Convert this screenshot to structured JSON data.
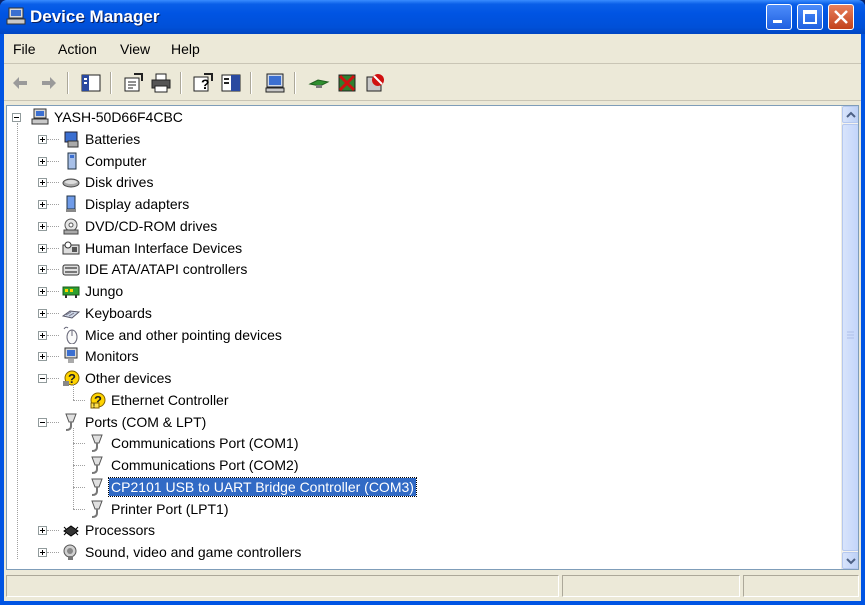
{
  "window": {
    "title": "Device Manager"
  },
  "menubar": {
    "items": [
      "File",
      "Action",
      "View",
      "Help"
    ]
  },
  "toolbar": {
    "buttons": [
      "back-icon",
      "forward-icon",
      "show-hide-tree-icon",
      "properties-icon",
      "print-icon",
      "help-icon",
      "console-tree-icon",
      "scan-hardware-icon",
      "update-driver-icon",
      "disable-icon",
      "uninstall-icon"
    ]
  },
  "tree": {
    "root": "YASH-50D66F4CBC",
    "categories": [
      {
        "label": "Batteries",
        "icon": "battery-icon"
      },
      {
        "label": "Computer",
        "icon": "computer-icon"
      },
      {
        "label": "Disk drives",
        "icon": "disk-drive-icon"
      },
      {
        "label": "Display adapters",
        "icon": "display-adapter-icon"
      },
      {
        "label": "DVD/CD-ROM drives",
        "icon": "dvd-drive-icon"
      },
      {
        "label": "Human Interface Devices",
        "icon": "hid-icon"
      },
      {
        "label": "IDE ATA/ATAPI controllers",
        "icon": "ide-controller-icon"
      },
      {
        "label": "Jungo",
        "icon": "jungo-icon"
      },
      {
        "label": "Keyboards",
        "icon": "keyboard-icon"
      },
      {
        "label": "Mice and other pointing devices",
        "icon": "mouse-icon"
      },
      {
        "label": "Monitors",
        "icon": "monitor-icon"
      },
      {
        "label": "Other devices",
        "icon": "unknown-device-icon",
        "expanded": true,
        "children": [
          {
            "label": "Ethernet Controller",
            "icon": "warning-device-icon"
          }
        ]
      },
      {
        "label": "Ports (COM & LPT)",
        "icon": "port-icon",
        "expanded": true,
        "children": [
          {
            "label": "Communications Port (COM1)",
            "icon": "port-icon"
          },
          {
            "label": "Communications Port (COM2)",
            "icon": "port-icon"
          },
          {
            "label": "CP2101 USB to UART Bridge Controller (COM3)",
            "icon": "port-icon",
            "selected": true
          },
          {
            "label": "Printer Port (LPT1)",
            "icon": "port-icon"
          }
        ]
      },
      {
        "label": "Processors",
        "icon": "processor-icon"
      },
      {
        "label": "Sound, video and game controllers",
        "icon": "sound-icon"
      }
    ]
  },
  "colors": {
    "selection": "#316ac5",
    "titlebar": "#0054e3",
    "chrome": "#ece9d8"
  }
}
